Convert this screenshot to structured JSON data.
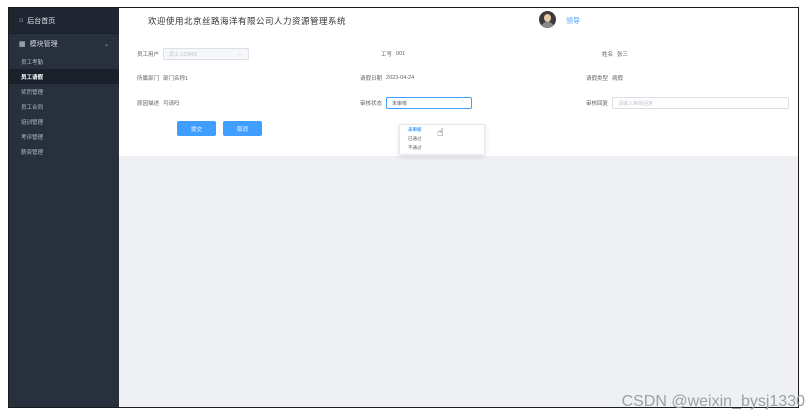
{
  "sidebar": {
    "home_label": "后台首页",
    "home_icon": "home-icon",
    "group_label": "模块管理",
    "group_icon": "grid-icon",
    "group_chevron": "chevron-down-icon",
    "items": [
      {
        "label": "员工考勤",
        "active": false
      },
      {
        "label": "员工请假",
        "active": true
      },
      {
        "label": "奖罚管理",
        "active": false
      },
      {
        "label": "员工合同",
        "active": false
      },
      {
        "label": "培训管理",
        "active": false
      },
      {
        "label": "考评管理",
        "active": false
      },
      {
        "label": "薪资管理",
        "active": false
      }
    ]
  },
  "header": {
    "title": "欢迎使用北京丝路海洋有限公司人力资源管理系统",
    "user_name": "领导"
  },
  "form": {
    "employee_user_label": "员工用户",
    "employee_user_value": "员工-123456",
    "employee_id_label": "工号",
    "employee_id_value": "001",
    "name_label": "姓名",
    "name_value": "张三",
    "department_label": "所属部门",
    "department_value": "部门名称1",
    "leave_date_label": "请假日期",
    "leave_date_value": "2023-04-24",
    "leave_type_label": "请假类型",
    "leave_type_value": "病假",
    "reason_label": "原因描述",
    "reason_value": "可请吗",
    "review_status_label": "审核状态",
    "review_status_value": "未审核",
    "review_reply_label": "审核回复",
    "review_reply_placeholder": "请输入审核回复",
    "submit_label": "提交",
    "cancel_label": "取消"
  },
  "dropdown": {
    "options": [
      "未审核",
      "已通过",
      "不通过"
    ],
    "selected": 0
  },
  "watermark": "CSDN @weixin_bysj1330",
  "colors": {
    "accent": "#409eff",
    "sidebar_bg": "#28303e",
    "content_bg": "#eef0f4"
  }
}
